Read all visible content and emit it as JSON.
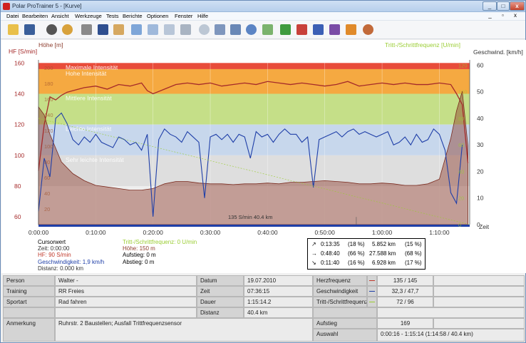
{
  "window": {
    "title": "Polar ProTrainer 5 - [Kurve]",
    "min": "_",
    "max": "□",
    "close": "x"
  },
  "menu": [
    "Datei",
    "Bearbeiten",
    "Ansicht",
    "Werkzeuge",
    "Tests",
    "Berichte",
    "Optionen",
    "Fenster",
    "Hilfe"
  ],
  "mdi": "_ ▫ x",
  "toolbar_icons": [
    "open-icon",
    "save-icon",
    "heart-rate-icon",
    "zones-icon",
    "calendar-icon",
    "book-icon",
    "person-edit-icon",
    "area-chart-icon",
    "bar-chart-icon",
    "percent-chart-icon",
    "columns-chart-icon",
    "zoom-icon",
    "sync-icon",
    "sync2-icon",
    "refresh-icon",
    "curve-icon",
    "report-green-icon",
    "report-red-icon",
    "report-blue-icon",
    "report-purple-icon",
    "report-orange-icon",
    "users-icon"
  ],
  "colors": {
    "hf": "#a52a2a",
    "speed": "#1f3fa8",
    "cadence": "#9acd32",
    "altitude": "#8b3a2a"
  },
  "chart_data": {
    "type": "line",
    "axes": {
      "hf_label": "HF [S/min]",
      "hf_ticks": [
        "160",
        "140",
        "120",
        "100",
        "80",
        "60"
      ],
      "alt_label": "Höhe [m]",
      "alt_ticks": [
        "200",
        "180",
        "160",
        "140",
        "120",
        "100",
        "80",
        "60",
        "40",
        "20"
      ],
      "cad_label": "Tritt-/Schrittfrequenz [U/min]",
      "speed_label": "Geschwind. [km/h]",
      "speed_ticks": [
        "60",
        "50",
        "40",
        "30",
        "20",
        "10",
        "0"
      ],
      "cad_ticks": [
        "120",
        "100",
        "80",
        "60",
        "40",
        "20",
        "0"
      ],
      "x_unit": "Zeit",
      "x_ticks": [
        "0:00:00",
        "0:10:00",
        "0:20:00",
        "0:30:00",
        "0:40:00",
        "0:50:00",
        "1:00:00",
        "1:10:00"
      ],
      "hf_ylim": [
        55,
        162
      ],
      "speed_ylim": [
        0,
        60
      ]
    },
    "zones": [
      {
        "label": "Maximale Intensität",
        "from": 156,
        "to": 160,
        "color": "#e84c3a"
      },
      {
        "label": "Hohe Intensität",
        "from": 140,
        "to": 156,
        "color": "#f5a941"
      },
      {
        "label": "Mittlere Intensität",
        "from": 120,
        "to": 140,
        "color": "#c5df88"
      },
      {
        "label": "Leichte Intensität",
        "from": 100,
        "to": 120,
        "color": "#c7d7ec"
      },
      {
        "label": "Sehr leichte Intensität",
        "from": 80,
        "to": 100,
        "color": "#dedede"
      }
    ],
    "zone_labels": [
      "Maximale Intensität",
      "Hohe Intensität",
      "Mittlere Intensität",
      "Leichte Intensität",
      "Sehr leichte Intensität"
    ],
    "series": [
      {
        "name": "HF",
        "unit": "S/min",
        "x": [
          0,
          1,
          2,
          3,
          4,
          5,
          6,
          8,
          10,
          12,
          14,
          16,
          18,
          19,
          20,
          22,
          24,
          26,
          28,
          30,
          32,
          34,
          36,
          38,
          40,
          42,
          44,
          46,
          48,
          50,
          52,
          54,
          56,
          58,
          60,
          62,
          64,
          66,
          68,
          70,
          72,
          73,
          74,
          75
        ],
        "values": [
          90,
          120,
          138,
          136,
          139,
          141,
          142,
          144,
          145,
          143,
          146,
          145,
          147,
          142,
          140,
          143,
          146,
          147,
          146,
          147,
          145,
          146,
          147,
          146,
          148,
          147,
          146,
          147,
          146,
          145,
          146,
          148,
          145,
          146,
          147,
          146,
          147,
          146,
          146,
          147,
          146,
          140,
          133,
          95
        ]
      },
      {
        "name": "Höhe",
        "unit": "m",
        "x": [
          0,
          1,
          2,
          4,
          6,
          8,
          10,
          12,
          14,
          16,
          18,
          20,
          22,
          24,
          26,
          28,
          30,
          32,
          34,
          36,
          38,
          40,
          42,
          44,
          46,
          48,
          50,
          52,
          54,
          56,
          58,
          60,
          62,
          64,
          66,
          68,
          70,
          72,
          73,
          74,
          75
        ],
        "values": [
          150,
          140,
          115,
          80,
          65,
          56,
          50,
          48,
          46,
          44,
          44,
          46,
          52,
          55,
          55,
          53,
          52,
          52,
          51,
          52,
          52,
          53,
          52,
          54,
          54,
          55,
          56,
          55,
          54,
          52,
          52,
          53,
          52,
          50,
          50,
          52,
          58,
          110,
          145,
          170,
          100
        ]
      },
      {
        "name": "Geschwindigkeit",
        "unit": "km/h",
        "x": [
          0,
          1,
          2,
          3,
          4,
          5,
          6,
          7,
          8,
          9,
          10,
          11,
          12,
          13,
          14,
          15,
          16,
          17,
          18,
          19,
          20,
          21,
          22,
          23,
          24,
          25,
          26,
          27,
          28,
          29,
          30,
          31,
          32,
          33,
          34,
          35,
          36,
          37,
          38,
          39,
          40,
          41,
          42,
          43,
          44,
          45,
          46,
          47,
          48,
          49,
          50,
          51,
          52,
          53,
          54,
          55,
          56,
          57,
          58,
          59,
          60,
          61,
          62,
          63,
          64,
          65,
          66,
          67,
          68,
          69,
          70,
          71,
          72,
          73,
          74
        ],
        "values": [
          5,
          25,
          18,
          40,
          42,
          38,
          32,
          30,
          33,
          31,
          34,
          31,
          30,
          29,
          33,
          32,
          30,
          31,
          28,
          34,
          3,
          32,
          36,
          34,
          33,
          31,
          35,
          33,
          31,
          10,
          33,
          34,
          32,
          34,
          31,
          34,
          33,
          25,
          35,
          33,
          34,
          31,
          34,
          36,
          34,
          34,
          31,
          33,
          14,
          32,
          33,
          34,
          35,
          33,
          35,
          36,
          34,
          35,
          34,
          33,
          34,
          35,
          30,
          31,
          33,
          30,
          34,
          31,
          32,
          36,
          34,
          28,
          12,
          8,
          30
        ]
      },
      {
        "name": "Tritt-/Schrittfrequenz",
        "unit": "U/min",
        "x": [
          0,
          5,
          10,
          20,
          30,
          40,
          50,
          60,
          70,
          75
        ],
        "values": [
          0,
          0,
          0,
          0,
          0,
          0,
          0,
          0,
          0,
          0
        ]
      }
    ],
    "marker": {
      "label": "135 S/min 40.4 km"
    }
  },
  "cursor_info": {
    "left": [
      "Cursorwert",
      "Zeit: 0:00:00",
      "HF: 90 S/min",
      "Geschwindigkeit: 1,9 km/h",
      "Distanz: 0.000 km"
    ],
    "mid": [
      "Tritt-/Schrittfrequenz: 0 U/min",
      "Höhe: 150 m",
      "Aufstieg: 0 m",
      "Abstieg: 0 m"
    ]
  },
  "gradient_summary": [
    {
      "arrow": "↗",
      "time": "0:13:35",
      "tpct": "(18 %)",
      "dist": "5.852 km",
      "dpct": "(15 %)"
    },
    {
      "arrow": "→",
      "time": "0:48:40",
      "tpct": "(66 %)",
      "dist": "27.588 km",
      "dpct": "(68 %)"
    },
    {
      "arrow": "↘",
      "time": "0:11:40",
      "tpct": "(16 %)",
      "dist": "6.928 km",
      "dpct": "(17 %)"
    }
  ],
  "summary": {
    "person_label": "Person",
    "person": "Walter -",
    "training_label": "Training",
    "training": "RR Freies",
    "sport_label": "Sportart",
    "sport": "Rad fahren",
    "note_label": "Anmerkung",
    "note": "Ruhrstr. 2 Baustellen; Ausfall Trittfrequenzsensor",
    "date_label": "Datum",
    "date": "19.07.2010",
    "time_label": "Zeit",
    "time": "07:36:15",
    "duration_label": "Dauer",
    "duration": "1:15:14.2",
    "distance_label": "Distanz",
    "distance": "40.4 km",
    "hr_label": "Herzfrequenz",
    "hr": "135 / 145",
    "speed_label": "Geschwindigkeit",
    "speed": "32,3 / 47,7",
    "cad_label": "Tritt-/Schrittfrequenz",
    "cad": "72 / 96",
    "ascent_label": "Aufstieg",
    "ascent": "169",
    "selection_label": "Auswahl",
    "selection": "0:00:16 - 1:15:14 (1:14:58 / 40.4 km)"
  }
}
